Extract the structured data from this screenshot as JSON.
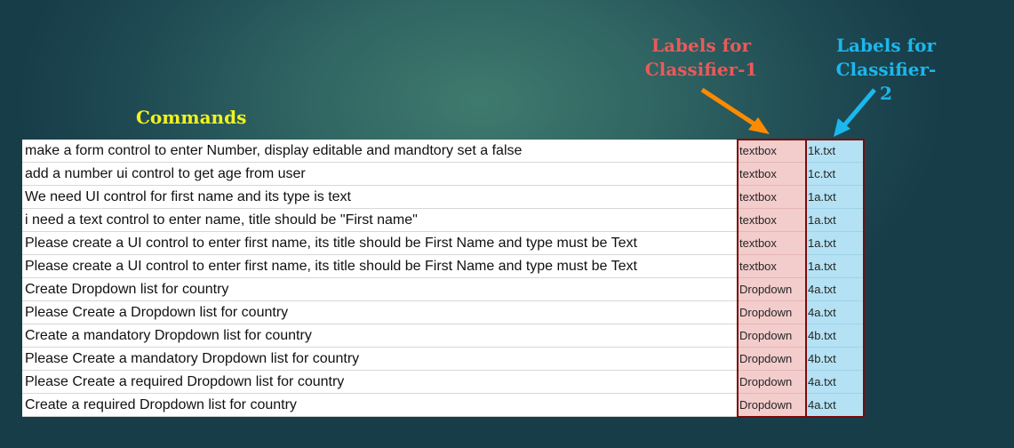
{
  "headings": {
    "commands": "Commands",
    "classifier1": "Labels for\nClassifier-1",
    "classifier2": "Labels for\nClassifier-\n2"
  },
  "colors": {
    "commands_heading": "#f2f21e",
    "classifier1_heading": "#e85a5a",
    "classifier2_heading": "#1cb7ec",
    "arrow_orange": "#ff8a00",
    "arrow_blue": "#1cb7ec",
    "label1_cell": "#f3cccc",
    "label2_cell": "#b4e2f4",
    "frame_border": "#7a0a0a"
  },
  "rows": [
    {
      "command": "make a form control to enter Number, display editable and mandtory set a false",
      "label1": "textbox",
      "label2": "1k.txt"
    },
    {
      "command": "add a number ui control to get age from user",
      "label1": "textbox",
      "label2": "1c.txt"
    },
    {
      "command": "We need UI control for first name and its type is text",
      "label1": "textbox",
      "label2": "1a.txt"
    },
    {
      "command": "i need a text control to enter name, title should be \"First name\"",
      "label1": "textbox",
      "label2": "1a.txt"
    },
    {
      "command": "Please create a UI control to enter first name, its title should be First Name and type must be Text",
      "label1": "textbox",
      "label2": "1a.txt"
    },
    {
      "command": "Please create a UI control to enter first name, its title should be First Name and type must be Text",
      "label1": "textbox",
      "label2": "1a.txt"
    },
    {
      "command": "Create Dropdown list for country",
      "label1": "Dropdown",
      "label2": "4a.txt"
    },
    {
      "command": "Please Create a Dropdown list for country",
      "label1": "Dropdown",
      "label2": "4a.txt"
    },
    {
      "command": "Create a mandatory Dropdown list for country",
      "label1": "Dropdown",
      "label2": "4b.txt"
    },
    {
      "command": "Please Create a mandatory Dropdown list for country",
      "label1": "Dropdown",
      "label2": "4b.txt"
    },
    {
      "command": "Please Create a required Dropdown list for country",
      "label1": "Dropdown",
      "label2": "4a.txt"
    },
    {
      "command": "Create a required Dropdown list for country",
      "label1": "Dropdown",
      "label2": "4a.txt"
    }
  ]
}
